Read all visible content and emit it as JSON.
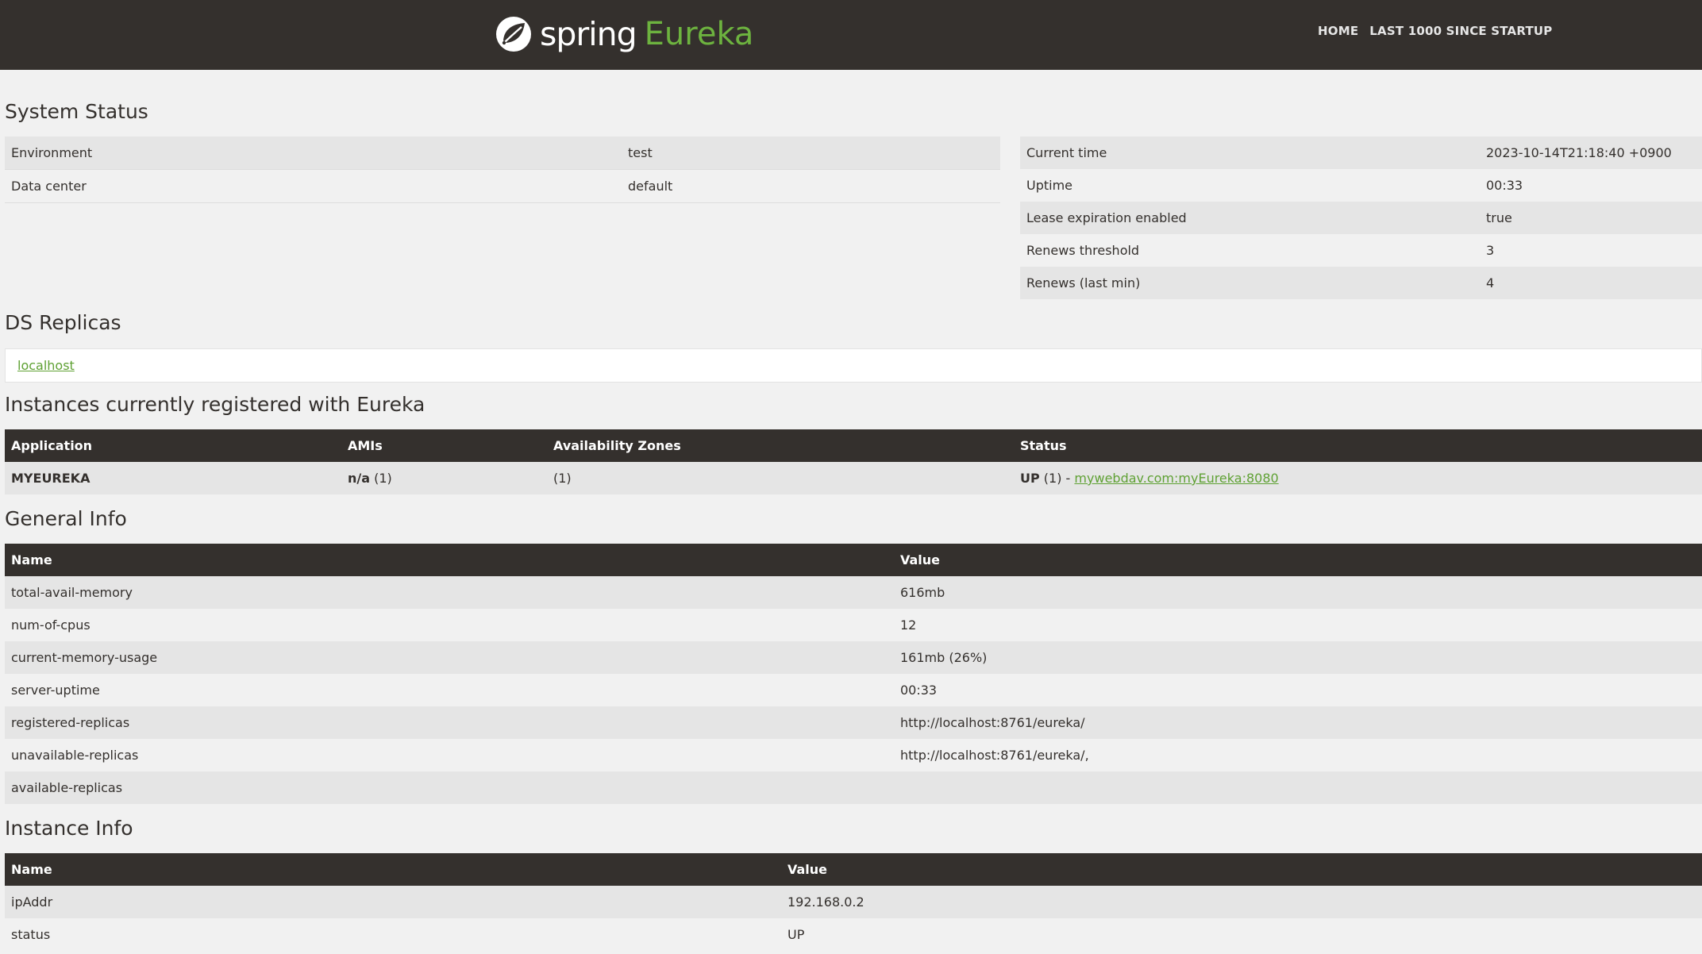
{
  "brand": {
    "spring": "spring",
    "eureka": "Eureka"
  },
  "nav": {
    "home": "HOME",
    "last1000": "LAST 1000 SINCE STARTUP"
  },
  "system_status": {
    "title": "System Status",
    "left": [
      {
        "name": "Environment",
        "value": "test"
      },
      {
        "name": "Data center",
        "value": "default"
      }
    ],
    "right": [
      {
        "name": "Current time",
        "value": "2023-10-14T21:18:40 +0900"
      },
      {
        "name": "Uptime",
        "value": "00:33"
      },
      {
        "name": "Lease expiration enabled",
        "value": "true"
      },
      {
        "name": "Renews threshold",
        "value": "3"
      },
      {
        "name": "Renews (last min)",
        "value": "4"
      }
    ]
  },
  "ds_replicas": {
    "title": "DS Replicas",
    "link": "localhost"
  },
  "instances": {
    "title": "Instances currently registered with Eureka",
    "headers": {
      "application": "Application",
      "amis": "AMIs",
      "zones": "Availability Zones",
      "status": "Status"
    },
    "rows": [
      {
        "application": "MYEUREKA",
        "amis_bold": "n/a",
        "amis_count": " (1)",
        "zones": "(1)",
        "status_bold": "UP",
        "status_count": " (1) - ",
        "status_link": "mywebdav.com:myEureka:8080"
      }
    ]
  },
  "general_info": {
    "title": "General Info",
    "headers": {
      "name": "Name",
      "value": "Value"
    },
    "rows": [
      {
        "name": "total-avail-memory",
        "value": "616mb"
      },
      {
        "name": "num-of-cpus",
        "value": "12"
      },
      {
        "name": "current-memory-usage",
        "value": "161mb (26%)"
      },
      {
        "name": "server-uptime",
        "value": "00:33"
      },
      {
        "name": "registered-replicas",
        "value": "http://localhost:8761/eureka/"
      },
      {
        "name": "unavailable-replicas",
        "value": "http://localhost:8761/eureka/,"
      },
      {
        "name": "available-replicas",
        "value": ""
      }
    ]
  },
  "instance_info": {
    "title": "Instance Info",
    "headers": {
      "name": "Name",
      "value": "Value"
    },
    "rows": [
      {
        "name": "ipAddr",
        "value": "192.168.0.2"
      },
      {
        "name": "status",
        "value": "UP"
      }
    ]
  },
  "colors": {
    "navbar": "#34302d",
    "accent": "#6db33f",
    "link": "#5fa134",
    "stripe": "#e5e5e5",
    "background": "#f1f1f1"
  },
  "icons": {
    "logo": "spring-leaf-logo-icon"
  }
}
